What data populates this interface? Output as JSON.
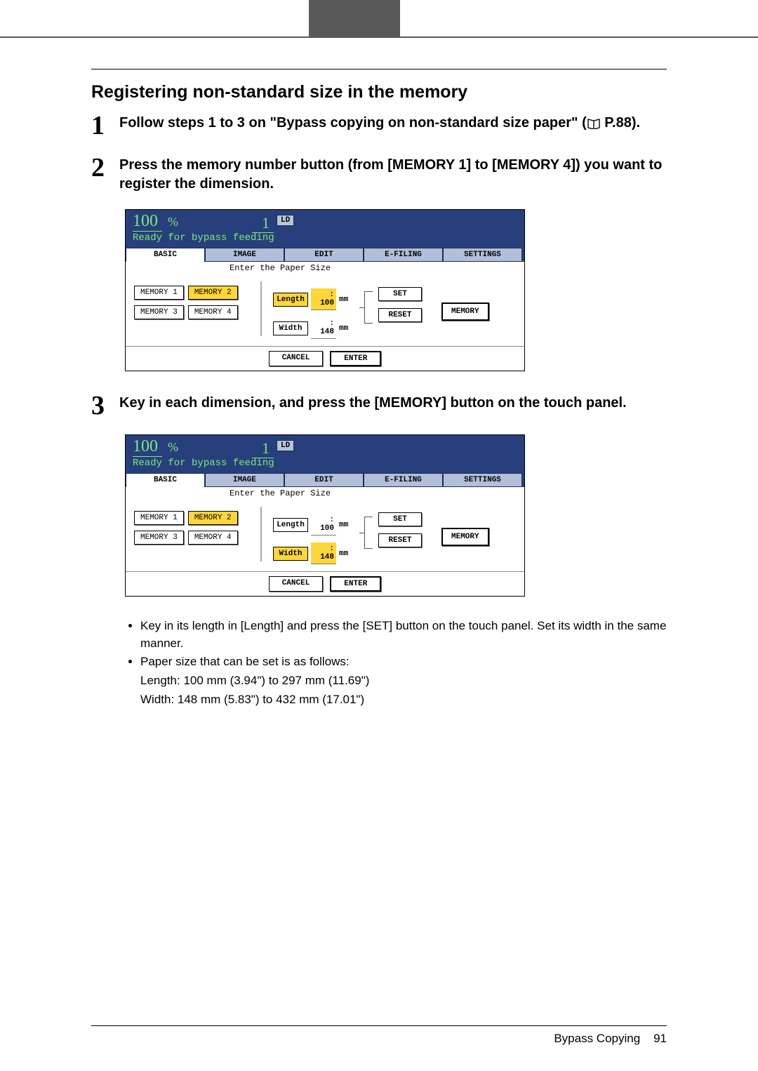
{
  "section_title": "Registering non-standard size in the memory",
  "steps": {
    "s1": {
      "num": "1",
      "text_a": "Follow steps 1 to 3 on \"Bypass copying on non-standard size paper\" (",
      "text_b": " P.88)."
    },
    "s2": {
      "num": "2",
      "text": "Press the memory number button (from [MEMORY 1] to [MEMORY 4]) you want to register the dimension."
    },
    "s3": {
      "num": "3",
      "text": "Key in each dimension, and press the [MEMORY] button on the touch panel."
    }
  },
  "panel1": {
    "pct": "100",
    "pct_sym": "%",
    "counter": "1",
    "ld": "LD",
    "status": "Ready for bypass feeding",
    "tabs": {
      "basic": "BASIC",
      "image": "IMAGE",
      "edit": "EDIT",
      "efiling": "E-FILING",
      "settings": "SETTINGS"
    },
    "enter": "Enter the Paper Size",
    "mem": {
      "m1": "MEMORY 1",
      "m2": "MEMORY 2",
      "m3": "MEMORY 3",
      "m4": "MEMORY 4"
    },
    "length_lbl": "Length",
    "length_val": ": 100",
    "unit": "mm",
    "width_lbl": "Width",
    "width_val": ": 148",
    "set": "SET",
    "reset": "RESET",
    "memory": "MEMORY",
    "cancel": "CANCEL",
    "enter_btn": "ENTER",
    "length_hl": true,
    "width_hl": false
  },
  "panel2": {
    "pct": "100",
    "pct_sym": "%",
    "counter": "1",
    "ld": "LD",
    "status": "Ready for bypass feeding",
    "tabs": {
      "basic": "BASIC",
      "image": "IMAGE",
      "edit": "EDIT",
      "efiling": "E-FILING",
      "settings": "SETTINGS"
    },
    "enter": "Enter the Paper Size",
    "mem": {
      "m1": "MEMORY 1",
      "m2": "MEMORY 2",
      "m3": "MEMORY 3",
      "m4": "MEMORY 4"
    },
    "length_lbl": "Length",
    "length_val": ": 100",
    "unit": "mm",
    "width_lbl": "Width",
    "width_val": ": 148",
    "set": "SET",
    "reset": "RESET",
    "memory": "MEMORY",
    "cancel": "CANCEL",
    "enter_btn": "ENTER"
  },
  "bullets": {
    "b1": "Key in its length in [Length] and press the [SET] button on the touch panel. Set its width in the same manner.",
    "b2": "Paper size that can be set is as follows:",
    "b2a": "Length: 100 mm (3.94\") to 297 mm (11.69\")",
    "b2b": "Width: 148 mm (5.83\") to 432 mm (17.01\")"
  },
  "footer": {
    "label": "Bypass Copying",
    "page": "91"
  }
}
